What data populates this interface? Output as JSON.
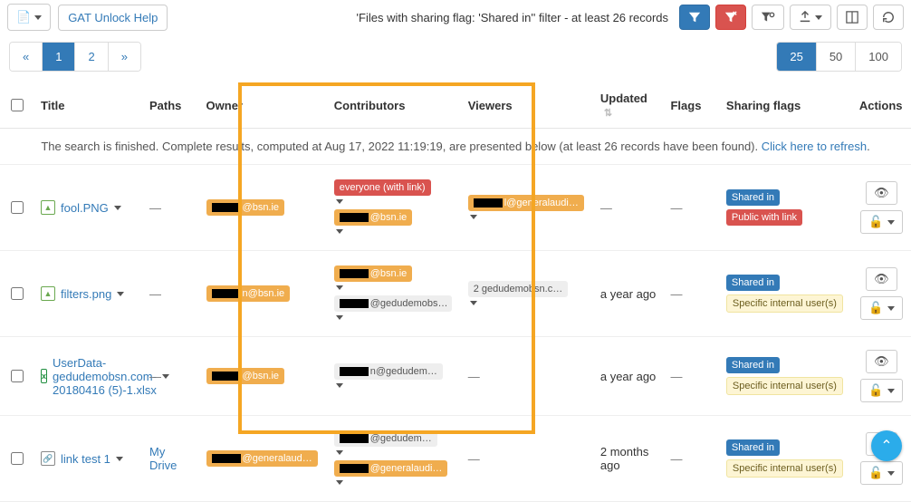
{
  "toolbar": {
    "help_label": "GAT Unlock Help",
    "filter_text": "'Files with sharing flag: 'Shared in'' filter -  at least 26 records"
  },
  "pagination": {
    "prev": "«",
    "pages": [
      "1",
      "2"
    ],
    "next": "»",
    "active_page": "1",
    "sizes": [
      "25",
      "50",
      "100"
    ],
    "active_size": "25"
  },
  "columns": {
    "check": "",
    "title": "Title",
    "paths": "Paths",
    "owner": "Owner",
    "contributors": "Contributors",
    "viewers": "Viewers",
    "updated": "Updated",
    "flags": "Flags",
    "sharing_flags": "Sharing flags",
    "actions": "Actions"
  },
  "info_banner": {
    "text": "The search is finished. Complete results, computed at Aug 17, 2022 11:19:19, are presented below (at least 26 records have been found). ",
    "refresh": "Click here to refresh"
  },
  "rows": [
    {
      "title": "fool.PNG",
      "file_kind": "img",
      "paths": "—",
      "owner_domain": "@bsn.ie",
      "contributors": [
        {
          "kind": "red",
          "text": "everyone (with link)"
        },
        {
          "kind": "orange",
          "redact": true,
          "text": "@bsn.ie"
        }
      ],
      "viewers": [
        {
          "kind": "orange",
          "redact": true,
          "text": "l@generalaudi…"
        }
      ],
      "updated": "—",
      "flags": "—",
      "sharing_flags": [
        "Shared in",
        "Public with link"
      ]
    },
    {
      "title": "filters.png",
      "file_kind": "img",
      "paths": "—",
      "owner_domain": "n@bsn.ie",
      "contributors": [
        {
          "kind": "orange",
          "redact": true,
          "text": "@bsn.ie"
        },
        {
          "kind": "gray",
          "redact": true,
          "text": "@gedudemobs…"
        }
      ],
      "viewers": [
        {
          "kind": "gray",
          "redact": false,
          "text": "2 gedudemobsn.c…"
        }
      ],
      "updated": "a year ago",
      "flags": "—",
      "sharing_flags": [
        "Shared in",
        "Specific internal user(s)"
      ]
    },
    {
      "title": "UserData-gedudemobsn.com-20180416 (5)-1.xlsx",
      "file_kind": "xlsx",
      "paths": "—",
      "owner_domain": "@bsn.ie",
      "contributors": [
        {
          "kind": "gray",
          "redact": true,
          "text": "n@gedudem…"
        }
      ],
      "viewers": [
        {
          "kind": "dash"
        }
      ],
      "updated": "a year ago",
      "flags": "—",
      "sharing_flags": [
        "Shared in",
        "Specific internal user(s)"
      ]
    },
    {
      "title": "link test 1",
      "file_kind": "link",
      "paths": "My Drive",
      "owner_domain": "@generalaud…",
      "contributors": [
        {
          "kind": "gray",
          "redact": true,
          "text": "@gedudem…"
        },
        {
          "kind": "orange",
          "redact": true,
          "text": "@generalaudi…"
        }
      ],
      "viewers": [
        {
          "kind": "dash"
        }
      ],
      "updated": "2 months ago",
      "flags": "—",
      "sharing_flags": [
        "Shared in",
        "Specific internal user(s)"
      ]
    }
  ],
  "icons": {
    "file": "📄",
    "eye": "👁",
    "lock": "🔓"
  }
}
